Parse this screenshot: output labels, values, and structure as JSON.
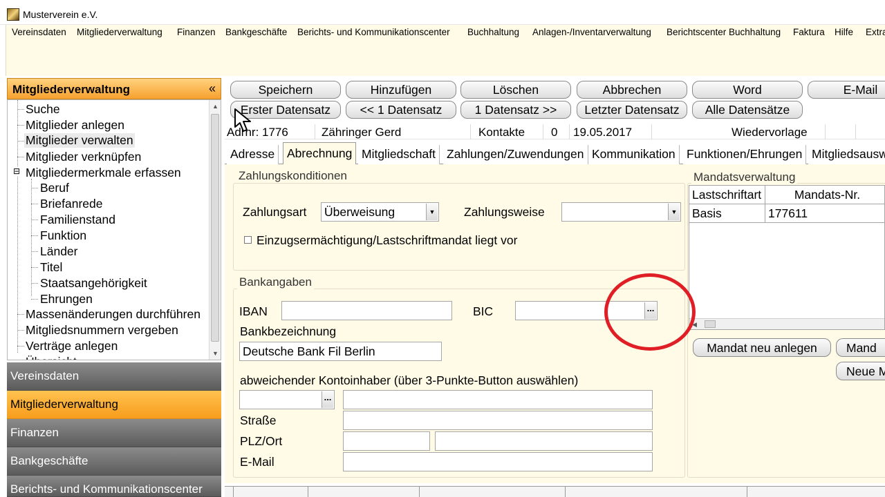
{
  "window": {
    "title": "Musterverein e.V."
  },
  "menu": [
    "Vereinsdaten",
    "Mitgliederverwaltung",
    "Finanzen",
    "Bankgeschäfte",
    "Berichts- und Kommunikationscenter",
    "Buchhaltung",
    "Anlagen-/Inventarverwaltung",
    "Berichtscenter Buchhaltung",
    "Faktura",
    "Hilfe",
    "Extra"
  ],
  "nav": {
    "header": "Mitgliederverwaltung",
    "collapse_glyph": "«",
    "tree": [
      "Suche",
      "Mitglieder anlegen",
      "Mitglieder verwalten",
      "Mitglieder verknüpfen",
      "Mitgliedermerkmale erfassen",
      "Beruf",
      "Briefanrede",
      "Familienstand",
      "Funktion",
      "Länder",
      "Titel",
      "Staatsangehörigkeit",
      "Ehrungen",
      "Massenänderungen durchführen",
      "Mitgliedsnummern vergeben",
      "Verträge anlegen",
      "Übersicht"
    ],
    "expand_glyph": "⊟",
    "sections": [
      "Vereinsdaten",
      "Mitgliederverwaltung",
      "Finanzen",
      "Bankgeschäfte",
      "Berichts- und Kommunikationscenter"
    ]
  },
  "toolbar": {
    "row1": [
      "Speichern",
      "Hinzufügen",
      "Löschen",
      "Abbrechen",
      "Word",
      "E-Mail"
    ],
    "row2": [
      "Erster Datensatz",
      "<< 1 Datensatz",
      "1 Datensatz >>",
      "Letzter Datensatz",
      "Alle Datensätze"
    ]
  },
  "record": {
    "adrnr": "Adrnr: 1776",
    "name": "Zähringer Gerd",
    "kontakte_label": "Kontakte",
    "kontakte_count": "0",
    "date": "19.05.2017",
    "wiedervorlage": "Wiedervorlage"
  },
  "tabs": [
    "Adresse",
    "Abrechnung",
    "Mitgliedschaft",
    "Zahlungen/Zuwendungen",
    "Kommunikation",
    "Funktionen/Ehrungen",
    "Mitgliedsausw"
  ],
  "active_tab_index": 1,
  "zahlung": {
    "title": "Zahlungskonditionen",
    "zahlungsart_label": "Zahlungsart",
    "zahlungsart_value": "Überweisung",
    "zahlungsweise_label": "Zahlungsweise",
    "zahlungsweise_value": "",
    "mandat_checkbox_label": "Einzugsermächtigung/Lastschriftmandat liegt vor"
  },
  "bank": {
    "title": "Bankangaben",
    "iban_label": "IBAN",
    "iban_value": "",
    "bic_label": "BIC",
    "bic_value": "",
    "bezeichnung_label": "Bankbezeichnung",
    "bezeichnung_value": "Deutsche Bank Fil Berlin",
    "abw_label": "abweichender Kontoinhaber (über 3-Punkte-Button auswählen)",
    "strasse_label": "Straße",
    "plz_label": "PLZ/Ort",
    "email_label": "E-Mail",
    "dots": "..."
  },
  "mandat": {
    "title": "Mandatsverwaltung",
    "columns": [
      "Lastschriftart",
      "Mandats-Nr."
    ],
    "rows": [
      [
        "Basis",
        "177611"
      ]
    ],
    "new_button": "Mandat neu anlegen",
    "button2": "Mand",
    "button3": "Neue M"
  },
  "colors": {
    "accent_orange": "#f7a12e",
    "panel_bg": "#fffbe6",
    "annotation_red": "#e01e26",
    "nav_gray": "#5b5b5b"
  }
}
